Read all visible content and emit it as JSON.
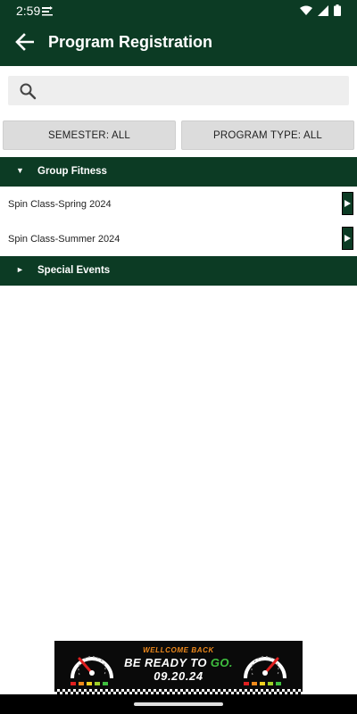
{
  "status_bar": {
    "time": "2:59",
    "notification_icon": "notification-icon",
    "icons": [
      "wifi-icon",
      "signal-icon",
      "battery-icon"
    ]
  },
  "app_bar": {
    "title": "Program Registration",
    "back_icon": "arrow-left-icon"
  },
  "search": {
    "icon": "search-icon",
    "placeholder": "",
    "value": ""
  },
  "filters": {
    "semester_label": "SEMESTER: ALL",
    "program_type_label": "PROGRAM TYPE: ALL"
  },
  "sections": [
    {
      "title": "Group Fitness",
      "expanded": true,
      "caret": "▼",
      "items": [
        {
          "label": "Spin Class-Spring 2024"
        },
        {
          "label": "Spin Class-Summer 2024"
        }
      ]
    },
    {
      "title": "Special Events",
      "expanded": false,
      "caret": "►",
      "items": []
    }
  ],
  "ad_banner": {
    "line1": "WELLCOME BACK",
    "line2_prefix": "BE READY TO ",
    "line2_highlight": "GO.",
    "line3": "09.20.24"
  },
  "colors": {
    "brand_green": "#0c3b24",
    "accent_orange": "#f08a1c",
    "accent_go_green": "#3fbf3f"
  }
}
